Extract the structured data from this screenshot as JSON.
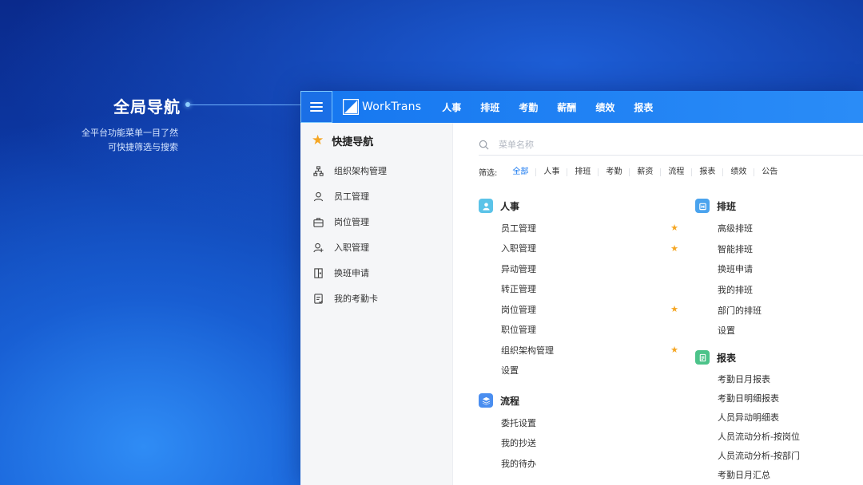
{
  "annotation": {
    "title": "全局导航",
    "desc_line1": "全平台功能菜单一目了然",
    "desc_line2": "可快捷筛选与搜索"
  },
  "app": {
    "logo_text": "WorkTrans",
    "nav": [
      "人事",
      "排班",
      "考勤",
      "薪酬",
      "绩效",
      "报表"
    ]
  },
  "sidebar": {
    "header": "快捷导航",
    "items": [
      {
        "label": "组织架构管理",
        "icon": "org-chart-icon"
      },
      {
        "label": "员工管理",
        "icon": "person-icon"
      },
      {
        "label": "岗位管理",
        "icon": "briefcase-icon"
      },
      {
        "label": "入职管理",
        "icon": "add-person-icon"
      },
      {
        "label": "换班申请",
        "icon": "door-icon"
      },
      {
        "label": "我的考勤卡",
        "icon": "card-icon"
      }
    ]
  },
  "search": {
    "placeholder": "菜单名称"
  },
  "filters": {
    "label": "筛选:",
    "options": [
      "全部",
      "人事",
      "排班",
      "考勤",
      "薪资",
      "流程",
      "报表",
      "绩效",
      "公告"
    ],
    "active": "全部"
  },
  "groups": {
    "hr": {
      "title": "人事",
      "color": "#5bc3e8",
      "items": [
        {
          "label": "员工管理",
          "fav": "★"
        },
        {
          "label": "入职管理",
          "fav": "★"
        },
        {
          "label": "异动管理",
          "fav": ""
        },
        {
          "label": "转正管理",
          "fav": ""
        },
        {
          "label": "岗位管理",
          "fav": "★"
        },
        {
          "label": "职位管理",
          "fav": ""
        },
        {
          "label": "组织架构管理",
          "fav": "★"
        },
        {
          "label": "设置",
          "fav": ""
        }
      ]
    },
    "process": {
      "title": "流程",
      "color": "#4a8ef0",
      "items": [
        {
          "label": "委托设置"
        },
        {
          "label": "我的抄送"
        },
        {
          "label": "我的待办"
        }
      ]
    },
    "schedule": {
      "title": "排班",
      "color": "#4aa3ee",
      "items": [
        {
          "label": "高级排班"
        },
        {
          "label": "智能排班"
        },
        {
          "label": "换班申请"
        },
        {
          "label": "我的排班"
        },
        {
          "label": "部门的排班"
        },
        {
          "label": "设置"
        }
      ]
    },
    "reports": {
      "title": "报表",
      "color": "#4cc38a",
      "items": [
        {
          "label": "考勤日月报表"
        },
        {
          "label": "考勤日明细报表"
        },
        {
          "label": "人员异动明细表"
        },
        {
          "label": "人员流动分析-按岗位"
        },
        {
          "label": "人员流动分析-按部门"
        },
        {
          "label": "考勤日月汇总"
        }
      ]
    }
  }
}
